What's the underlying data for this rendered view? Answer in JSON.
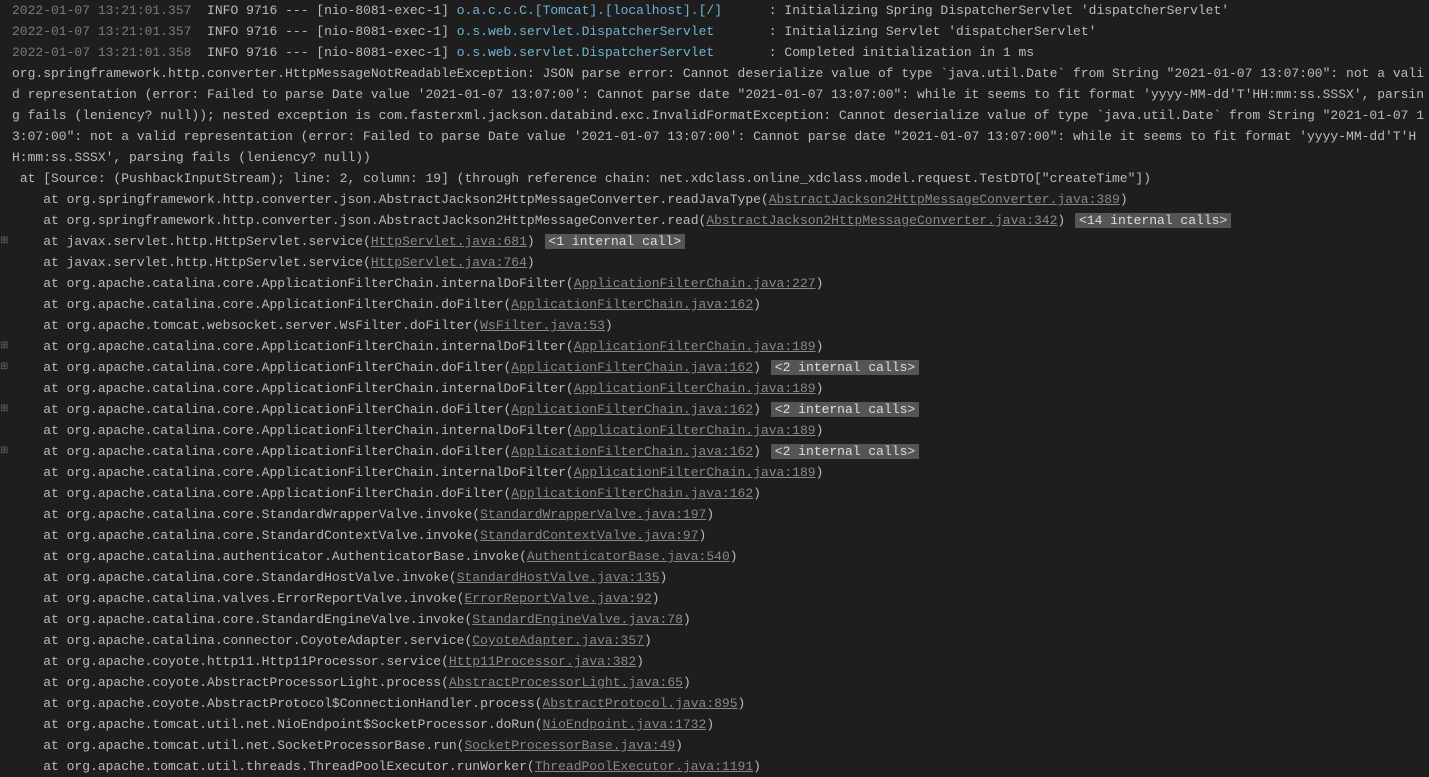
{
  "gutter": {
    "expand_marks": [
      11,
      16,
      17,
      19,
      21
    ],
    "expand_glyph": "⊞"
  },
  "logLines": [
    {
      "ts": "2022-01-07 13:21:01.357",
      "lvl": "INFO",
      "pid": "9716",
      "thr": "[nio-8081-exec-1]",
      "logger": "o.a.c.c.C.[Tomcat].[localhost].[/]",
      "msg": "Initializing Spring DispatcherServlet 'dispatcherServlet'"
    },
    {
      "ts": "2022-01-07 13:21:01.357",
      "lvl": "INFO",
      "pid": "9716",
      "thr": "[nio-8081-exec-1]",
      "logger": "o.s.web.servlet.DispatcherServlet",
      "msg": "Initializing Servlet 'dispatcherServlet'"
    },
    {
      "ts": "2022-01-07 13:21:01.358",
      "lvl": "INFO",
      "pid": "9716",
      "thr": "[nio-8081-exec-1]",
      "logger": "o.s.web.servlet.DispatcherServlet",
      "msg": "Completed initialization in 1 ms"
    }
  ],
  "exception": "org.springframework.http.converter.HttpMessageNotReadableException: JSON parse error: Cannot deserialize value of type `java.util.Date` from String \"2021-01-07 13:07:00\": not a valid representation (error: Failed to parse Date value '2021-01-07 13:07:00': Cannot parse date \"2021-01-07 13:07:00\": while it seems to fit format 'yyyy-MM-dd'T'HH:mm:ss.SSSX', parsing fails (leniency? null)); nested exception is com.fasterxml.jackson.databind.exc.InvalidFormatException: Cannot deserialize value of type `java.util.Date` from String \"2021-01-07 13:07:00\": not a valid representation (error: Failed to parse Date value '2021-01-07 13:07:00': Cannot parse date \"2021-01-07 13:07:00\": while it seems to fit format 'yyyy-MM-dd'T'HH:mm:ss.SSSX', parsing fails (leniency? null))",
  "source": " at [Source: (PushbackInputStream); line: 2, column: 19] (through reference chain: net.xdclass.online_xdclass.model.request.TestDTO[\"createTime\"])",
  "stack": [
    {
      "pre": "    at org.springframework.http.converter.json.AbstractJackson2HttpMessageConverter.readJavaType(",
      "link": "AbstractJackson2HttpMessageConverter.java:389",
      "post": ")",
      "badge": null
    },
    {
      "pre": "    at org.springframework.http.converter.json.AbstractJackson2HttpMessageConverter.read(",
      "link": "AbstractJackson2HttpMessageConverter.java:342",
      "post": ")",
      "badge": "<14 internal calls>"
    },
    {
      "pre": "    at javax.servlet.http.HttpServlet.service(",
      "link": "HttpServlet.java:681",
      "post": ")",
      "badge": "<1 internal call>"
    },
    {
      "pre": "    at javax.servlet.http.HttpServlet.service(",
      "link": "HttpServlet.java:764",
      "post": ")",
      "badge": null
    },
    {
      "pre": "    at org.apache.catalina.core.ApplicationFilterChain.internalDoFilter(",
      "link": "ApplicationFilterChain.java:227",
      "post": ")",
      "badge": null
    },
    {
      "pre": "    at org.apache.catalina.core.ApplicationFilterChain.doFilter(",
      "link": "ApplicationFilterChain.java:162",
      "post": ")",
      "badge": null
    },
    {
      "pre": "    at org.apache.tomcat.websocket.server.WsFilter.doFilter(",
      "link": "WsFilter.java:53",
      "post": ")",
      "badge": null
    },
    {
      "pre": "    at org.apache.catalina.core.ApplicationFilterChain.internalDoFilter(",
      "link": "ApplicationFilterChain.java:189",
      "post": ")",
      "badge": null
    },
    {
      "pre": "    at org.apache.catalina.core.ApplicationFilterChain.doFilter(",
      "link": "ApplicationFilterChain.java:162",
      "post": ")",
      "badge": "<2 internal calls>"
    },
    {
      "pre": "    at org.apache.catalina.core.ApplicationFilterChain.internalDoFilter(",
      "link": "ApplicationFilterChain.java:189",
      "post": ")",
      "badge": null
    },
    {
      "pre": "    at org.apache.catalina.core.ApplicationFilterChain.doFilter(",
      "link": "ApplicationFilterChain.java:162",
      "post": ")",
      "badge": "<2 internal calls>"
    },
    {
      "pre": "    at org.apache.catalina.core.ApplicationFilterChain.internalDoFilter(",
      "link": "ApplicationFilterChain.java:189",
      "post": ")",
      "badge": null
    },
    {
      "pre": "    at org.apache.catalina.core.ApplicationFilterChain.doFilter(",
      "link": "ApplicationFilterChain.java:162",
      "post": ")",
      "badge": "<2 internal calls>"
    },
    {
      "pre": "    at org.apache.catalina.core.ApplicationFilterChain.internalDoFilter(",
      "link": "ApplicationFilterChain.java:189",
      "post": ")",
      "badge": null
    },
    {
      "pre": "    at org.apache.catalina.core.ApplicationFilterChain.doFilter(",
      "link": "ApplicationFilterChain.java:162",
      "post": ")",
      "badge": null
    },
    {
      "pre": "    at org.apache.catalina.core.StandardWrapperValve.invoke(",
      "link": "StandardWrapperValve.java:197",
      "post": ")",
      "badge": null
    },
    {
      "pre": "    at org.apache.catalina.core.StandardContextValve.invoke(",
      "link": "StandardContextValve.java:97",
      "post": ")",
      "badge": null
    },
    {
      "pre": "    at org.apache.catalina.authenticator.AuthenticatorBase.invoke(",
      "link": "AuthenticatorBase.java:540",
      "post": ")",
      "badge": null
    },
    {
      "pre": "    at org.apache.catalina.core.StandardHostValve.invoke(",
      "link": "StandardHostValve.java:135",
      "post": ")",
      "badge": null
    },
    {
      "pre": "    at org.apache.catalina.valves.ErrorReportValve.invoke(",
      "link": "ErrorReportValve.java:92",
      "post": ")",
      "badge": null
    },
    {
      "pre": "    at org.apache.catalina.core.StandardEngineValve.invoke(",
      "link": "StandardEngineValve.java:78",
      "post": ")",
      "badge": null
    },
    {
      "pre": "    at org.apache.catalina.connector.CoyoteAdapter.service(",
      "link": "CoyoteAdapter.java:357",
      "post": ")",
      "badge": null
    },
    {
      "pre": "    at org.apache.coyote.http11.Http11Processor.service(",
      "link": "Http11Processor.java:382",
      "post": ")",
      "badge": null
    },
    {
      "pre": "    at org.apache.coyote.AbstractProcessorLight.process(",
      "link": "AbstractProcessorLight.java:65",
      "post": ")",
      "badge": null
    },
    {
      "pre": "    at org.apache.coyote.AbstractProtocol$ConnectionHandler.process(",
      "link": "AbstractProtocol.java:895",
      "post": ")",
      "badge": null
    },
    {
      "pre": "    at org.apache.tomcat.util.net.NioEndpoint$SocketProcessor.doRun(",
      "link": "NioEndpoint.java:1732",
      "post": ")",
      "badge": null
    },
    {
      "pre": "    at org.apache.tomcat.util.net.SocketProcessorBase.run(",
      "link": "SocketProcessorBase.java:49",
      "post": ")",
      "badge": null
    },
    {
      "pre": "    at org.apache.tomcat.util.threads.ThreadPoolExecutor.runWorker(",
      "link": "ThreadPoolExecutor.java:1191",
      "post": ")",
      "badge": null
    }
  ],
  "padWidths": {
    "logger": 39
  }
}
